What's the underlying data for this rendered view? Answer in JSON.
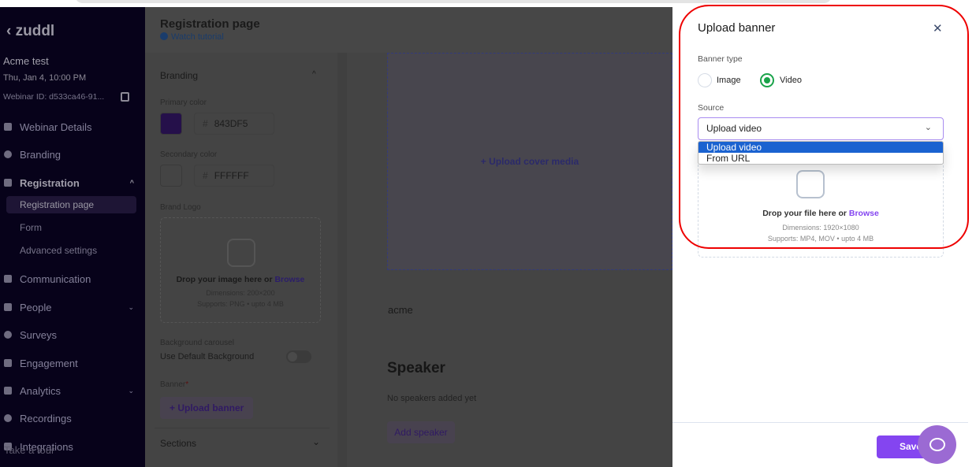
{
  "sidebar": {
    "logo": "zuddl",
    "event_name": "Acme test",
    "event_date": "Thu, Jan 4, 10:00 PM",
    "webinar_id": "Webinar ID: d533ca46-91...",
    "items": [
      {
        "label": "Webinar Details"
      },
      {
        "label": "Branding"
      },
      {
        "label": "Registration"
      },
      {
        "label": "Communication"
      },
      {
        "label": "People"
      },
      {
        "label": "Surveys"
      },
      {
        "label": "Engagement"
      },
      {
        "label": "Analytics"
      },
      {
        "label": "Recordings"
      },
      {
        "label": "Integrations"
      }
    ],
    "sub_items": [
      {
        "label": "Registration page"
      },
      {
        "label": "Form"
      },
      {
        "label": "Advanced settings"
      }
    ],
    "take_tour": "Take a tour"
  },
  "header": {
    "title": "Registration page",
    "tutorial": "Watch tutorial"
  },
  "config": {
    "branding": "Branding",
    "primary_label": "Primary color",
    "primary_hex": "843DF5",
    "secondary_label": "Secondary color",
    "secondary_hex": "FFFFFF",
    "hash": "#",
    "brand_logo": "Brand Logo",
    "drop_text": "Drop your image here or ",
    "browse": "Browse",
    "dimensions": "Dimensions: 200×200",
    "supports": "Supports: PNG • upto 4 MB",
    "bg_carousel": "Background carousel",
    "use_default": "Use Default Background",
    "banner_label": "Banner",
    "required": "*",
    "upload_banner": "Upload banner",
    "sections": "Sections"
  },
  "preview": {
    "upload_cover": "Upload cover media",
    "org": "acme",
    "speaker_title": "Speaker",
    "no_speakers": "No speakers added yet",
    "add_speaker": "Add speaker"
  },
  "panel": {
    "title": "Upload banner",
    "banner_type": "Banner type",
    "type_image": "Image",
    "type_video": "Video",
    "source": "Source",
    "source_value": "Upload video",
    "options": [
      "Upload video",
      "From URL"
    ],
    "drop_text": "Drop your file here or ",
    "browse": "Browse",
    "dimensions": "Dimensions: 1920×1080",
    "supports": "Supports: MP4, MOV • upto 4 MB",
    "save": "Save"
  },
  "colors": {
    "accent": "#8445f0",
    "primary": "#843DF5",
    "radio_on": "#1aa34a"
  }
}
